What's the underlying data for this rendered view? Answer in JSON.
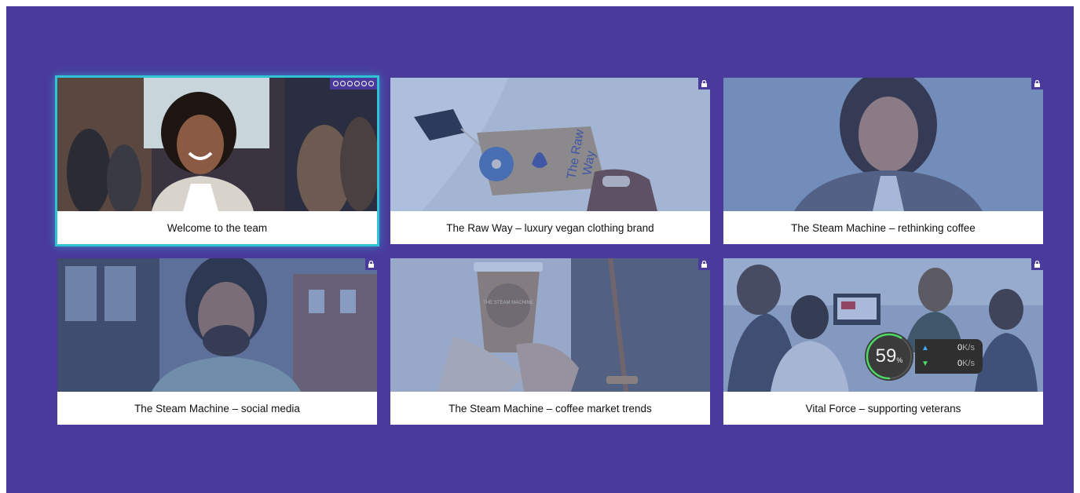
{
  "cards": [
    {
      "caption": "Welcome to the team",
      "badge": "progress-dots",
      "selected": true
    },
    {
      "caption": "The Raw Way – luxury vegan clothing brand",
      "badge": "lock"
    },
    {
      "caption": "The Steam Machine – rethinking coffee",
      "badge": "lock"
    },
    {
      "caption": "The Steam Machine – social media",
      "badge": "lock"
    },
    {
      "caption": "The Steam Machine – coffee market trends",
      "badge": "lock"
    },
    {
      "caption": "Vital Force – supporting veterans",
      "badge": "lock"
    }
  ],
  "tag_text": [
    "The Raw",
    "Way"
  ],
  "cup_text": "THE STEAM MACHINE",
  "network_widget": {
    "percent": "59",
    "percent_unit": "%",
    "upload_value": "0",
    "upload_unit": "K/s",
    "download_value": "0",
    "download_unit": "K/s",
    "gauge_fraction": 0.59
  },
  "colors": {
    "background": "#4a3a9c",
    "selection": "#2ec4d6"
  }
}
